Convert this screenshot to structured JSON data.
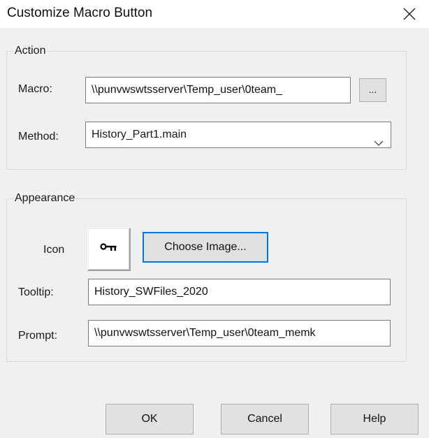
{
  "window": {
    "title": "Customize Macro Button",
    "close_icon": "close-icon"
  },
  "action": {
    "group_label": "Action",
    "macro_label": "Macro:",
    "macro_value": "\\\\punvwswtsserver\\Temp_user\\0team_",
    "browse_label": "...",
    "method_label": "Method:",
    "method_value": "History_Part1.main"
  },
  "appearance": {
    "group_label": "Appearance",
    "icon_label": "Icon",
    "icon_name": "key-icon",
    "choose_image_label": "Choose Image...",
    "tooltip_label": "Tooltip:",
    "tooltip_value": "History_SWFiles_2020",
    "prompt_label": "Prompt:",
    "prompt_value": "\\\\punvwswtsserver\\Temp_user\\0team_memk"
  },
  "buttons": {
    "ok": "OK",
    "cancel": "Cancel",
    "help": "Help"
  },
  "colors": {
    "focus_accent": "#0078d7",
    "dialog_bg": "#f0f0f0",
    "titlebar_bg": "#ffffff"
  }
}
